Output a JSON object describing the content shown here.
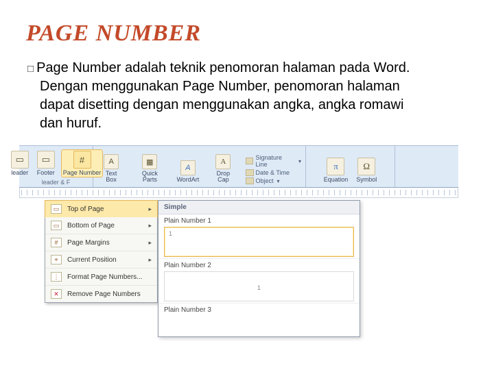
{
  "title": "PAGE NUMBER",
  "body": "Page Number adalah teknik penomoran halaman pada Word. Dengan menggunakan Page Number, penomoran halaman dapat disetting dengan menggunakan angka, angka romawi dan huruf.",
  "ribbon": {
    "hf_group": "leader & F",
    "hf_header": "leader",
    "hf_footer": "Footer",
    "hf_pagenum": "Page Number",
    "text_group": "",
    "text_box": "Text Box",
    "quick_parts": "Quick Parts",
    "wordart": "WordArt",
    "drop_cap": "Drop Cap",
    "sig_line": "Signature Line",
    "date_time": "Date & Time",
    "object": "Object",
    "equation": "Equation",
    "symbol": "Symbol"
  },
  "menu": {
    "top": "Top of Page",
    "bottom": "Bottom of Page",
    "margins": "Page Margins",
    "current": "Current Position",
    "format": "Format Page Numbers...",
    "remove": "Remove Page Numbers"
  },
  "submenu": {
    "group": "Simple",
    "p1": "Plain Number 1",
    "p2": "Plain Number 2",
    "p3": "Plain Number 3",
    "sample": "1"
  }
}
